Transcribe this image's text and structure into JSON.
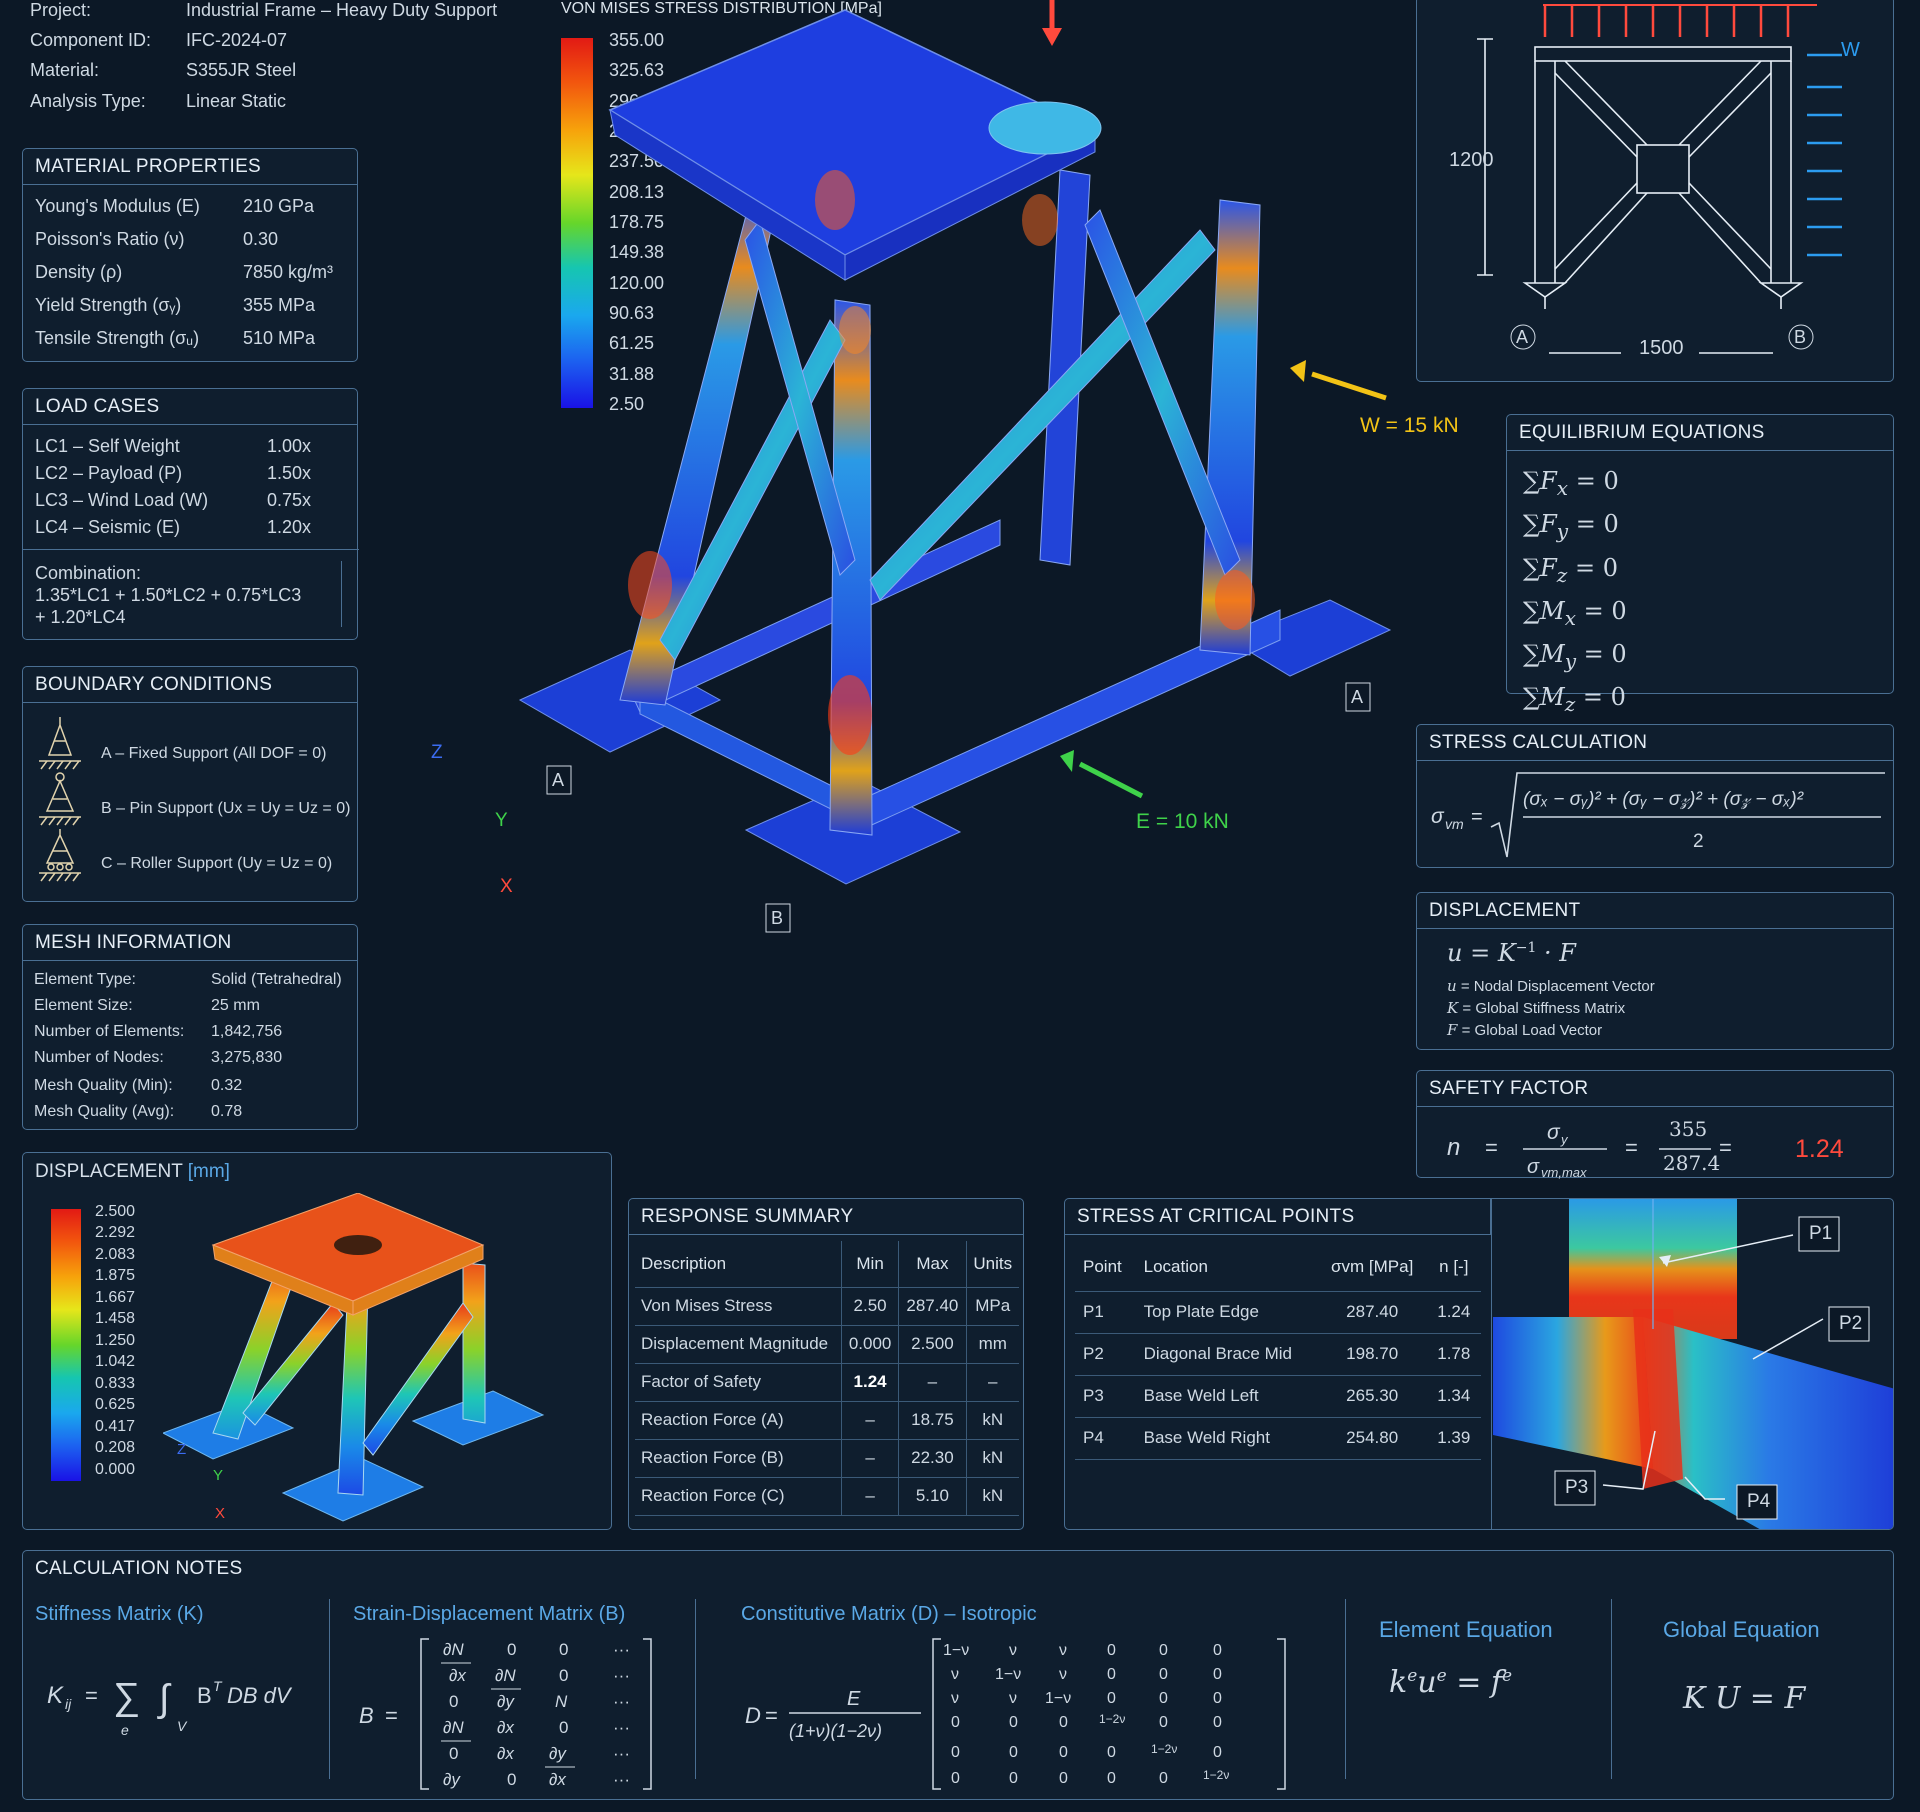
{
  "project": {
    "rows": [
      {
        "k": "Project:",
        "v": "Industrial Frame – Heavy Duty Support"
      },
      {
        "k": "Component ID:",
        "v": "IFC-2024-07"
      },
      {
        "k": "Material:",
        "v": "S355JR Steel"
      },
      {
        "k": "Analysis Type:",
        "v": "Linear Static"
      }
    ]
  },
  "material": {
    "title": "MATERIAL PROPERTIES",
    "rows": [
      {
        "k": "Young's Modulus (E)",
        "v": "210 GPa"
      },
      {
        "k": "Poisson's Ratio (ν)",
        "v": "0.30"
      },
      {
        "k": "Density (ρ)",
        "v": "7850 kg/m³"
      },
      {
        "k": "Yield Strength (σᵧ)",
        "v": "355 MPa"
      },
      {
        "k": "Tensile Strength (σᵤ)",
        "v": "510 MPa"
      }
    ]
  },
  "loads": {
    "title": "LOAD CASES",
    "rows": [
      {
        "k": "LC1 – Self Weight",
        "v": "1.00x"
      },
      {
        "k": "LC2 – Payload (P)",
        "v": "1.50x"
      },
      {
        "k": "LC3 – Wind Load (W)",
        "v": "0.75x"
      },
      {
        "k": "LC4 – Seismic (E)",
        "v": "1.20x"
      }
    ],
    "combo_label": "Combination:",
    "combo_1": "1.35*LC1 + 1.50*LC2 + 0.75*LC3",
    "combo_2": "+ 1.20*LC4"
  },
  "boundary": {
    "title": "BOUNDARY CONDITIONS",
    "items": [
      "A – Fixed Support (All DOF = 0)",
      "B – Pin Support (Ux = Uy = Uz = 0)",
      "C – Roller Support (Uy = Uz = 0)"
    ]
  },
  "mesh": {
    "title": "MESH INFORMATION",
    "rows": [
      {
        "k": "Element Type:",
        "v": "Solid (Tetrahedral)"
      },
      {
        "k": "Element Size:",
        "v": "25 mm"
      },
      {
        "k": "Number of Elements:",
        "v": "1,842,756"
      },
      {
        "k": "Number of Nodes:",
        "v": "3,275,830"
      },
      {
        "k": "Mesh Quality (Min):",
        "v": "0.32"
      },
      {
        "k": "Mesh Quality (Avg):",
        "v": "0.78"
      }
    ]
  },
  "stress_legend": {
    "title": "VON MISES STRESS DISTRIBUTION [MPa]",
    "values": [
      "355.00",
      "325.63",
      "296.25",
      "266.88",
      "237.50",
      "208.13",
      "178.75",
      "149.38",
      "120.00",
      "90.63",
      "61.25",
      "31.88",
      "2.50"
    ]
  },
  "viewport": {
    "w_label": "W = 15 kN",
    "e_label": "E = 10 kN",
    "support_a": "A",
    "support_b": "B",
    "axis_x": "X",
    "axis_y": "Y",
    "axis_z": "Z"
  },
  "diagram": {
    "dim_h": "1200",
    "dim_w": "1500",
    "w": "W",
    "a": "A",
    "b": "B"
  },
  "equilibrium": {
    "title": "EQUILIBRIUM EQUATIONS",
    "eqs": [
      [
        "F",
        "x"
      ],
      [
        "F",
        "y"
      ],
      [
        "F",
        "z"
      ],
      [
        "M",
        "x"
      ],
      [
        "M",
        "y"
      ],
      [
        "M",
        "z"
      ]
    ],
    "zero": "= 0"
  },
  "stress_calc": {
    "title": "STRESS CALCULATION"
  },
  "displacement_eq": {
    "title": "DISPLACEMENT",
    "rows": [
      {
        "s": "u",
        "d": "Nodal Displacement Vector"
      },
      {
        "s": "K",
        "d": "Global Stiffness Matrix"
      },
      {
        "s": "F",
        "d": "Global Load Vector"
      }
    ]
  },
  "safety": {
    "title": "SAFETY FACTOR",
    "num": "355",
    "den": "287.4",
    "result": "1.24"
  },
  "disp_plot": {
    "title": "DISPLACEMENT",
    "unit": "[mm]",
    "values": [
      "2.500",
      "2.292",
      "2.083",
      "1.875",
      "1.667",
      "1.458",
      "1.250",
      "1.042",
      "0.833",
      "0.625",
      "0.417",
      "0.208",
      "0.000"
    ]
  },
  "response": {
    "title": "RESPONSE SUMMARY",
    "headers": [
      "Description",
      "Min",
      "Max",
      "Units"
    ],
    "rows": [
      [
        "Von Mises Stress",
        "2.50",
        "287.40",
        "MPa"
      ],
      [
        "Displacement Magnitude",
        "0.000",
        "2.500",
        "mm"
      ],
      [
        "Factor of Safety",
        "1.24",
        "–",
        "–"
      ],
      [
        "Reaction Force (A)",
        "–",
        "18.75",
        "kN"
      ],
      [
        "Reaction Force (B)",
        "–",
        "22.30",
        "kN"
      ],
      [
        "Reaction Force (C)",
        "–",
        "5.10",
        "kN"
      ]
    ]
  },
  "critical": {
    "title": "STRESS AT CRITICAL POINTS",
    "headers": [
      "Point",
      "Location",
      "σvm [MPa]",
      "n [-]"
    ],
    "rows": [
      [
        "P1",
        "Top Plate Edge",
        "287.40",
        "1.24"
      ],
      [
        "P2",
        "Diagonal Brace Mid",
        "198.70",
        "1.78"
      ],
      [
        "P3",
        "Base Weld Left",
        "265.30",
        "1.34"
      ],
      [
        "P4",
        "Base Weld Right",
        "254.80",
        "1.39"
      ]
    ],
    "callouts": [
      "P1",
      "P2",
      "P3",
      "P4"
    ]
  },
  "notes": {
    "title": "CALCULATION NOTES",
    "stiffness": "Stiffness Matrix (K)",
    "strain": "Strain-Displacement Matrix (B)",
    "constitutive": "Constitutive Matrix (D) – Isotropic",
    "element": "Element Equation",
    "global": "Global Equation"
  },
  "colors": {
    "panel_border": "#4a6f93",
    "background": "#0c1826",
    "accent_red": "#ff4a3d",
    "accent_yellow": "#f3c316",
    "accent_green": "#3fd24a",
    "accent_blue": "#2c9cf0"
  }
}
